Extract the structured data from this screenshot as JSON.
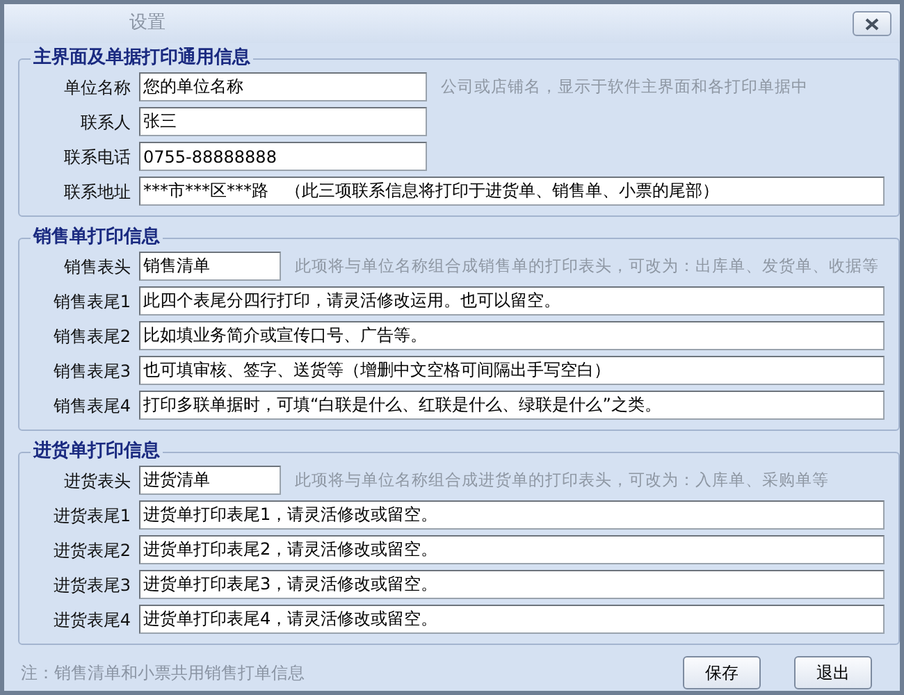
{
  "window": {
    "title": "设置"
  },
  "groups": [
    {
      "title": "主界面及单据打印通用信息",
      "fields": [
        {
          "label": "单位名称",
          "value": "您的单位名称",
          "kind": "medium",
          "hint": "公司或店铺名，显示于软件主界面和各打印单据中"
        },
        {
          "label": "联系人",
          "value": "张三",
          "kind": "medium"
        },
        {
          "label": "联系电话",
          "value": "0755-88888888",
          "kind": "medium"
        },
        {
          "label": "联系地址",
          "value": "***市***区***路　（此三项联系信息将打印于进货单、销售单、小票的尾部）",
          "kind": "wide"
        }
      ]
    },
    {
      "title": "销售单打印信息",
      "fields": [
        {
          "label": "销售表头",
          "value": "销售清单",
          "kind": "short",
          "hint": "此项将与单位名称组合成销售单的打印表头，可改为：出库单、发货单、收据等"
        },
        {
          "label": "销售表尾1",
          "value": "此四个表尾分四行打印，请灵活修改运用。也可以留空。",
          "kind": "wide"
        },
        {
          "label": "销售表尾2",
          "value": "比如填业务简介或宣传口号、广告等。",
          "kind": "wide"
        },
        {
          "label": "销售表尾3",
          "value": "也可填审核、签字、送货等（增删中文空格可间隔出手写空白）",
          "kind": "wide"
        },
        {
          "label": "销售表尾4",
          "value": "打印多联单据时，可填“白联是什么、红联是什么、绿联是什么”之类。",
          "kind": "wide"
        }
      ]
    },
    {
      "title": "进货单打印信息",
      "fields": [
        {
          "label": "进货表头",
          "value": "进货清单",
          "kind": "short",
          "hint": "此项将与单位名称组合成进货单的打印表头，可改为：入库单、采购单等"
        },
        {
          "label": "进货表尾1",
          "value": "进货单打印表尾1，请灵活修改或留空。",
          "kind": "wide"
        },
        {
          "label": "进货表尾2",
          "value": "进货单打印表尾2，请灵活修改或留空。",
          "kind": "wide"
        },
        {
          "label": "进货表尾3",
          "value": "进货单打印表尾3，请灵活修改或留空。",
          "kind": "wide"
        },
        {
          "label": "进货表尾4",
          "value": "进货单打印表尾4，请灵活修改或留空。",
          "kind": "wide"
        }
      ]
    }
  ],
  "note": "注：销售清单和小票共用销售打单信息",
  "buttons": [
    "保存",
    "退出"
  ]
}
